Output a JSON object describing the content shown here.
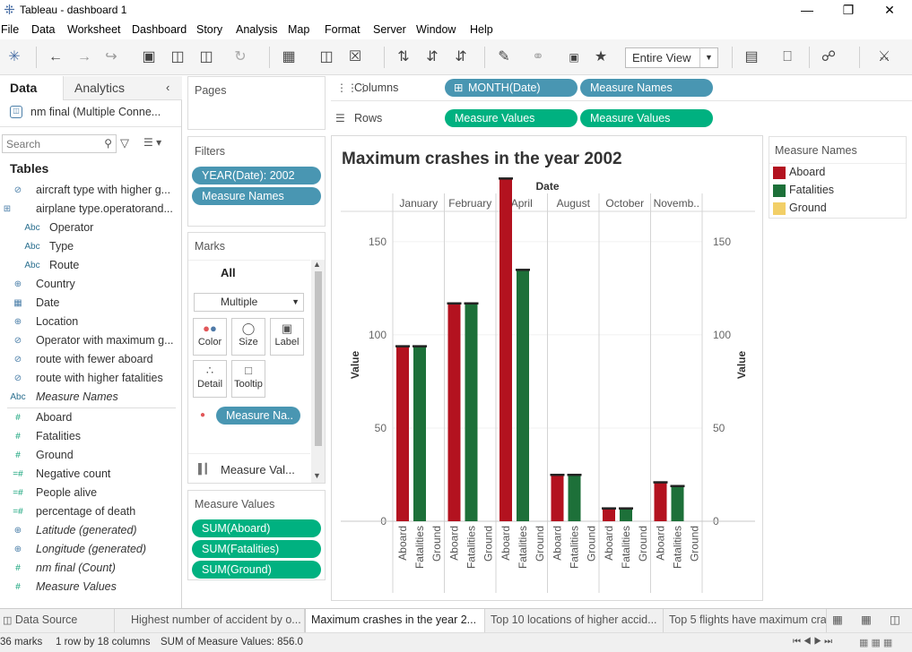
{
  "window": {
    "title": "Tableau - dashboard 1"
  },
  "menu": [
    "File",
    "Data",
    "Worksheet",
    "Dashboard",
    "Story",
    "Analysis",
    "Map",
    "Format",
    "Server",
    "Window",
    "Help"
  ],
  "toolbar": {
    "view_select": "Entire View"
  },
  "data_pane": {
    "tab_data": "Data",
    "tab_analytics": "Analytics",
    "connection": "nm final (Multiple Conne...",
    "search_placeholder": "Search",
    "tables_heading": "Tables",
    "fields": [
      {
        "icon": "link-icon",
        "glyph": "⊘",
        "label": "aircraft type with higher g...",
        "indent": 1
      },
      {
        "icon": "table-icon",
        "glyph": "⊞",
        "label": "airplane type.operatorand...",
        "indent": 0
      },
      {
        "icon": "abc-icon",
        "glyph": "Abc",
        "label": "Operator",
        "indent": 2
      },
      {
        "icon": "abc-icon",
        "glyph": "Abc",
        "label": "Type",
        "indent": 2
      },
      {
        "icon": "abc-icon",
        "glyph": "Abc",
        "label": "Route",
        "indent": 2
      },
      {
        "icon": "geo-icon",
        "glyph": "⊕",
        "label": "Country",
        "indent": 1
      },
      {
        "icon": "date-icon",
        "glyph": "▦",
        "label": "Date",
        "indent": 1
      },
      {
        "icon": "globe-icon",
        "glyph": "⊕",
        "label": "Location",
        "indent": 1
      },
      {
        "icon": "link-icon",
        "glyph": "⊘",
        "label": "Operator with maximum g...",
        "indent": 1
      },
      {
        "icon": "clip-icon",
        "glyph": "⊘",
        "label": "route with fewer aboard",
        "indent": 1
      },
      {
        "icon": "clip-icon",
        "glyph": "⊘",
        "label": "route with higher fatalities",
        "indent": 1
      },
      {
        "icon": "abc-icon",
        "glyph": "Abc",
        "label": "Measure Names",
        "indent": 0,
        "italic": true
      },
      {
        "icon": "hash-icon",
        "glyph": "#",
        "label": "Aboard",
        "indent": 1
      },
      {
        "icon": "hash-icon",
        "glyph": "#",
        "label": "Fatalities",
        "indent": 1
      },
      {
        "icon": "hash-icon",
        "glyph": "#",
        "label": "Ground",
        "indent": 1
      },
      {
        "icon": "calc-hash-icon",
        "glyph": "=#",
        "label": "Negative count",
        "indent": 1
      },
      {
        "icon": "calc-hash-icon",
        "glyph": "=#",
        "label": "People alive",
        "indent": 1
      },
      {
        "icon": "calc-hash-icon",
        "glyph": "=#",
        "label": "percentage of death",
        "indent": 1
      },
      {
        "icon": "globe-icon",
        "glyph": "⊕",
        "label": "Latitude (generated)",
        "indent": 1,
        "italic": true
      },
      {
        "icon": "globe-icon",
        "glyph": "⊕",
        "label": "Longitude (generated)",
        "indent": 1,
        "italic": true
      },
      {
        "icon": "hash-icon",
        "glyph": "#",
        "label": "nm final (Count)",
        "indent": 1,
        "italic": true
      },
      {
        "icon": "hash-icon",
        "glyph": "#",
        "label": "Measure Values",
        "indent": 1,
        "italic": true
      }
    ]
  },
  "shelves": {
    "pages": "Pages",
    "filters": "Filters",
    "filter_pills": [
      "YEAR(Date): 2002",
      "Measure Names"
    ],
    "marks": "Marks",
    "marks_all": "All",
    "marks_type": "Multiple",
    "mark_buttons": [
      "Color",
      "Size",
      "Label",
      "Detail",
      "Tooltip"
    ],
    "color_pill": "Measure Na..",
    "measure_values_row": "Measure Val...",
    "measure_values": "Measure Values",
    "mv_pills": [
      "SUM(Aboard)",
      "SUM(Fatalities)",
      "SUM(Ground)"
    ],
    "columns_label": "Columns",
    "rows_label": "Rows",
    "columns_pills": [
      "MONTH(Date)",
      "Measure Names"
    ],
    "rows_pills": [
      "Measure Values",
      "Measure Values"
    ]
  },
  "legend": {
    "title": "Measure Names",
    "items": [
      {
        "label": "Aboard",
        "color": "#b3121f"
      },
      {
        "label": "Fatalities",
        "color": "#1d7039"
      },
      {
        "label": "Ground",
        "color": "#f2cf67"
      }
    ]
  },
  "bottom_tabs": [
    "Data Source",
    "Highest number of accident by o...",
    "Maximum crashes in the year 2...",
    "Top 10 locations of higher accid...",
    "Top 5 flights have maximum cra"
  ],
  "status": {
    "marks": "36 marks",
    "rows_cols": "1 row by 18 columns",
    "sum": "SUM of Measure Values: 856.0"
  },
  "chart_data": {
    "type": "bar",
    "title": "Maximum crashes in the year 2002",
    "header": "Date",
    "ylabel": "Value",
    "ylim": [
      0,
      185
    ],
    "yticks": [
      0,
      50,
      100,
      150
    ],
    "categories": [
      "January",
      "February",
      "April",
      "August",
      "October",
      "Novemb.."
    ],
    "measures": [
      "Aboard",
      "Fatalities",
      "Ground"
    ],
    "series": [
      {
        "name": "Aboard",
        "color": "#b3121f",
        "values": [
          94,
          117,
          184,
          25,
          7,
          21
        ]
      },
      {
        "name": "Fatalities",
        "color": "#1d7039",
        "values": [
          94,
          117,
          135,
          25,
          7,
          19
        ]
      },
      {
        "name": "Ground",
        "color": "#f2cf67",
        "values": [
          0,
          0,
          0,
          0,
          0,
          0
        ]
      }
    ]
  }
}
